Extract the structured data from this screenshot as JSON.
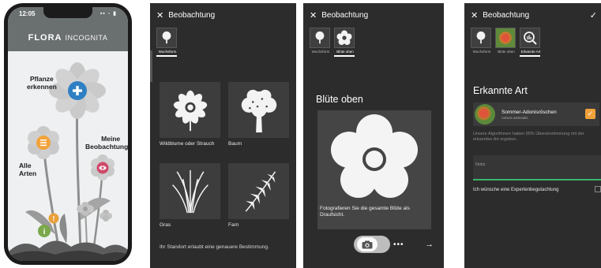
{
  "home": {
    "status_time": "12:05",
    "status_icons": "▪▪ ◦ ▮",
    "logo_main": "FLORA",
    "logo_sub": "INCOGNITA",
    "label_identify": "Pflanze\nerkennen",
    "label_observations": "Meine\nBeobachtungen",
    "label_all": "Alle\nArten",
    "colors": {
      "header": "#6a6f70",
      "identify": "#2f7fc2",
      "all": "#f2a33a",
      "observations": "#cf4a6a",
      "help": "#e8a03a",
      "info": "#7aa84a"
    }
  },
  "screen2": {
    "title": "Beobachtung",
    "tabs": [
      {
        "label": "Wuchsform",
        "icon": "tree-icon",
        "active": true
      }
    ],
    "cards": [
      {
        "label": "Wildblume oder Strauch",
        "icon": "flower-icon"
      },
      {
        "label": "Baum",
        "icon": "tree-icon"
      },
      {
        "label": "Gras",
        "icon": "grass-icon"
      },
      {
        "label": "Farn",
        "icon": "fern-icon"
      }
    ],
    "footnote": "Ihr Standort erlaubt eine genauere Bestimmung."
  },
  "screen3": {
    "title": "Beobachtung",
    "tabs": [
      {
        "label": "Wuchsform",
        "icon": "tree-icon",
        "active": false
      },
      {
        "label": "Blüte oben",
        "icon": "flower-top-icon",
        "active": true
      }
    ],
    "heading": "Blüte oben",
    "hint": "Fotografieren Sie die gesamte Blüte als Draufsicht."
  },
  "screen4": {
    "title": "Beobachtung",
    "tabs": [
      {
        "label": "Wuchsform",
        "icon": "tree-icon",
        "active": false
      },
      {
        "label": "Blüte oben",
        "icon": "photo-thumb-icon",
        "active": false
      },
      {
        "label": "Erkannte Art",
        "icon": "magnifier-icon",
        "active": true
      }
    ],
    "heading": "Erkannte Art",
    "result_name": "Sommer-Adonisröschen",
    "result_sub": "Adonis aestivalis",
    "info_text": "Unsere Algorithmen haben 95% Übereinstimmung mit der erkannten Art ergeben.",
    "note_placeholder": "Notiz",
    "expert_label": "Ich wünsche eine Expertenbegutachtung",
    "colors": {
      "accent": "#f0a13a",
      "line": "#3bb56a"
    }
  }
}
